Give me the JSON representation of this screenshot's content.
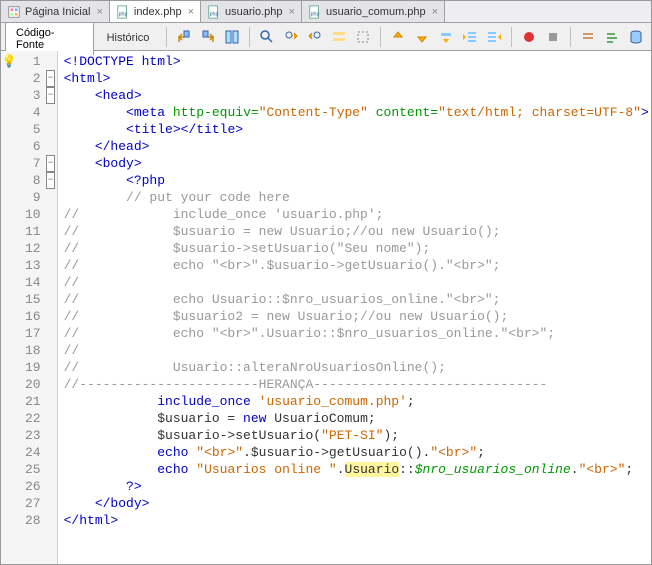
{
  "tabs": [
    {
      "label": "Página Inicial",
      "type": "home"
    },
    {
      "label": "index.php",
      "type": "php",
      "active": true
    },
    {
      "label": "usuario.php",
      "type": "php"
    },
    {
      "label": "usuario_comum.php",
      "type": "php"
    }
  ],
  "subtabs": {
    "source": "Código-Fonte",
    "history": "Histórico"
  },
  "toolbar_icons": [
    "export-up",
    "export-down",
    "stack",
    "find",
    "prev",
    "next",
    "select-all",
    "select-mode",
    "step-up",
    "step-over",
    "step-return",
    "step-into",
    "step-out",
    "record",
    "camera",
    "comments",
    "db"
  ],
  "code": {
    "lines": [
      {
        "n": 1,
        "fold": "",
        "mark": "bulb",
        "html": "<span class='tag'>&lt;!DOCTYPE html&gt;</span>"
      },
      {
        "n": 2,
        "fold": "-",
        "html": "<span class='tag'>&lt;html&gt;</span>"
      },
      {
        "n": 3,
        "fold": "-",
        "html": "    <span class='tag'>&lt;head&gt;</span>"
      },
      {
        "n": 4,
        "html": "        <span class='tag'>&lt;meta</span> <span class='attr'>http-equiv=</span><span class='str'>\"Content-Type\"</span> <span class='attr'>content=</span><span class='str'>\"text/html; charset=UTF-8\"</span><span class='tag'>&gt;</span>"
      },
      {
        "n": 5,
        "html": "        <span class='tag'>&lt;title&gt;&lt;/title&gt;</span>"
      },
      {
        "n": 6,
        "html": "    <span class='tag'>&lt;/head&gt;</span>"
      },
      {
        "n": 7,
        "fold": "-",
        "html": "    <span class='tag'>&lt;body&gt;</span>"
      },
      {
        "n": 8,
        "fold": "-",
        "html": "        <span class='kw2'>&lt;?php</span>"
      },
      {
        "n": 9,
        "html": "        <span class='com'>// put your code here</span>"
      },
      {
        "n": 10,
        "html": "<span class='com'>//            include_once 'usuario.php';</span>"
      },
      {
        "n": 11,
        "html": "<span class='com'>//            $usuario = new Usuario;//ou new Usuario();</span>"
      },
      {
        "n": 12,
        "html": "<span class='com'>//            $usuario-&gt;setUsuario(\"Seu nome\");</span>"
      },
      {
        "n": 13,
        "html": "<span class='com'>//            echo \"&lt;br&gt;\".$usuario-&gt;getUsuario().\"&lt;br&gt;\";</span>"
      },
      {
        "n": 14,
        "html": "<span class='com'>//</span>"
      },
      {
        "n": 15,
        "html": "<span class='com'>//            echo Usuario::$nro_usuarios_online.\"&lt;br&gt;\";</span>"
      },
      {
        "n": 16,
        "html": "<span class='com'>//            $usuario2 = new Usuario;//ou new Usuario();</span>"
      },
      {
        "n": 17,
        "html": "<span class='com'>//            echo \"&lt;br&gt;\".Usuario::$nro_usuarios_online.\"&lt;br&gt;\";</span>"
      },
      {
        "n": 18,
        "html": "<span class='com'>//</span>"
      },
      {
        "n": 19,
        "html": "<span class='com'>//            Usuario::alteraNroUsuariosOnline();</span>"
      },
      {
        "n": 20,
        "html": "<span class='com'>//-----------------------HERANÇA------------------------------</span>"
      },
      {
        "n": 21,
        "html": "            <span class='kw'>include_once</span> <span class='str'>'usuario_comum.php'</span>;"
      },
      {
        "n": 22,
        "html": "            $usuario = <span class='kw'>new</span> UsuarioComum;"
      },
      {
        "n": 23,
        "html": "            $usuario-&gt;setUsuario(<span class='str'>\"PET-SI\"</span>);"
      },
      {
        "n": 24,
        "html": "            <span class='kw'>echo</span> <span class='str'>\"&lt;br&gt;\"</span>.$usuario-&gt;getUsuario().<span class='str'>\"&lt;br&gt;\"</span>;"
      },
      {
        "n": 25,
        "html": "            <span class='kw'>echo</span> <span class='str'>\"Usuarios online \"</span>.<span class='hl'>Usuario</span>::<span class='stc'>$nro_usuarios_online</span>.<span class='str'>\"&lt;br&gt;\"</span>;"
      },
      {
        "n": 26,
        "html": "        <span class='kw2'>?&gt;</span>"
      },
      {
        "n": 27,
        "html": "    <span class='tag'>&lt;/body&gt;</span>"
      },
      {
        "n": 28,
        "html": "<span class='tag'>&lt;/html&gt;</span>"
      }
    ]
  }
}
